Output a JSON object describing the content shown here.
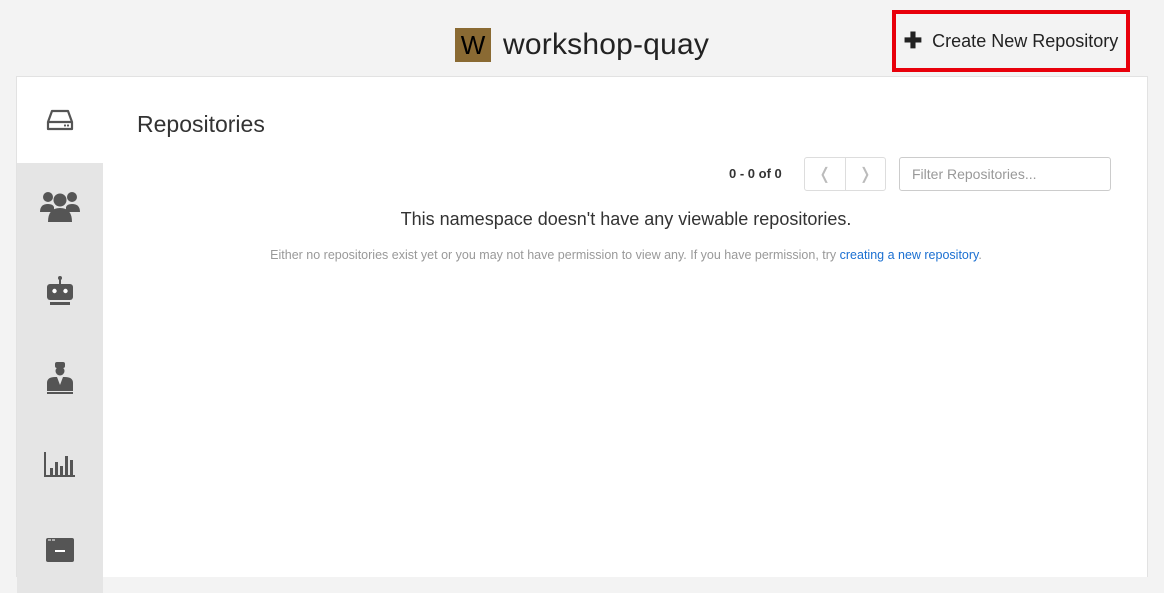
{
  "header": {
    "namespace_initial": "W",
    "namespace_name": "workshop-quay",
    "create_button_label": "Create New Repository"
  },
  "sidebar": {
    "items": [
      {
        "icon": "hdd-icon",
        "active": true
      },
      {
        "icon": "users-icon",
        "active": false
      },
      {
        "icon": "robot-icon",
        "active": false
      },
      {
        "icon": "user-admin-icon",
        "active": false
      },
      {
        "icon": "bar-chart-icon",
        "active": false
      },
      {
        "icon": "window-icon",
        "active": false
      }
    ]
  },
  "main": {
    "title": "Repositories",
    "pagination": {
      "count_text": "0 - 0 of 0"
    },
    "filter": {
      "placeholder": "Filter Repositories..."
    },
    "empty": {
      "heading": "This namespace doesn't have any viewable repositories.",
      "description": "Either no repositories exist yet or you may not have permission to view any. If you have permission, try ",
      "link_text": "creating a new repository",
      "suffix": "."
    }
  },
  "colors": {
    "namespace_avatar": "#8a6a33",
    "highlight_border": "#e8000b",
    "link": "#1a6fd1",
    "sidebar_bg": "#e5e5e5",
    "icon": "#555555"
  }
}
